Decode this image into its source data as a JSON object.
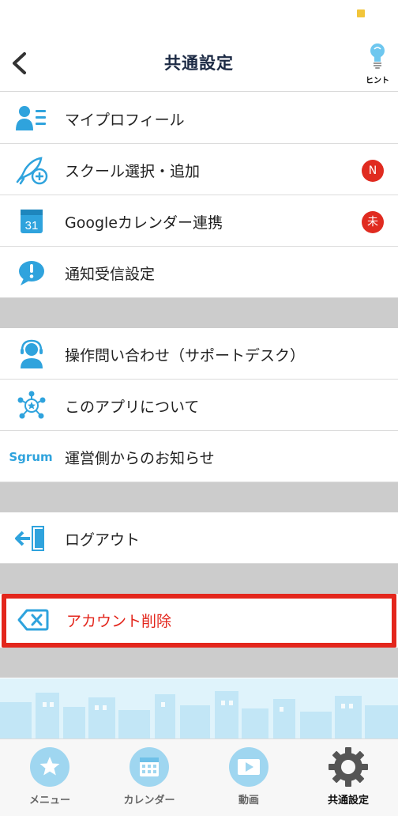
{
  "header": {
    "title": "共通設定",
    "hint_label": "ヒント"
  },
  "menu": {
    "group1": [
      {
        "label": "マイプロフィール",
        "icon": "profile-list-icon"
      },
      {
        "label": "スクール選択・追加",
        "icon": "rocket-add-icon",
        "badge": "N"
      },
      {
        "label": "Googleカレンダー連携",
        "icon": "calendar-31-icon",
        "calendar_day": "31",
        "badge": "未"
      },
      {
        "label": "通知受信設定",
        "icon": "speech-bubble-exclamation-icon"
      }
    ],
    "group2": [
      {
        "label": "操作問い合わせ（サポートデスク）",
        "icon": "headset-support-icon"
      },
      {
        "label": "このアプリについて",
        "icon": "network-star-icon"
      },
      {
        "label": "運営側からのお知らせ",
        "icon": "sgrum-logo",
        "logo_text": "Sgrum"
      }
    ],
    "group3": [
      {
        "label": "ログアウト",
        "icon": "logout-door-icon"
      }
    ],
    "group4": [
      {
        "label": "アカウント削除",
        "icon": "backspace-delete-icon"
      }
    ]
  },
  "tabbar": {
    "tabs": [
      {
        "label": "メニュー",
        "icon": "menu-star-icon",
        "active": false
      },
      {
        "label": "カレンダー",
        "icon": "calendar-icon",
        "active": false
      },
      {
        "label": "動画",
        "icon": "video-icon",
        "active": false
      },
      {
        "label": "共通設定",
        "icon": "gear-icon",
        "active": true
      }
    ]
  },
  "colors": {
    "accent_blue": "#2fa3dd",
    "danger_red": "#e3261c",
    "badge_red": "#e02b20",
    "title_navy": "#1c2a44",
    "divider_gray": "#cccccc"
  }
}
